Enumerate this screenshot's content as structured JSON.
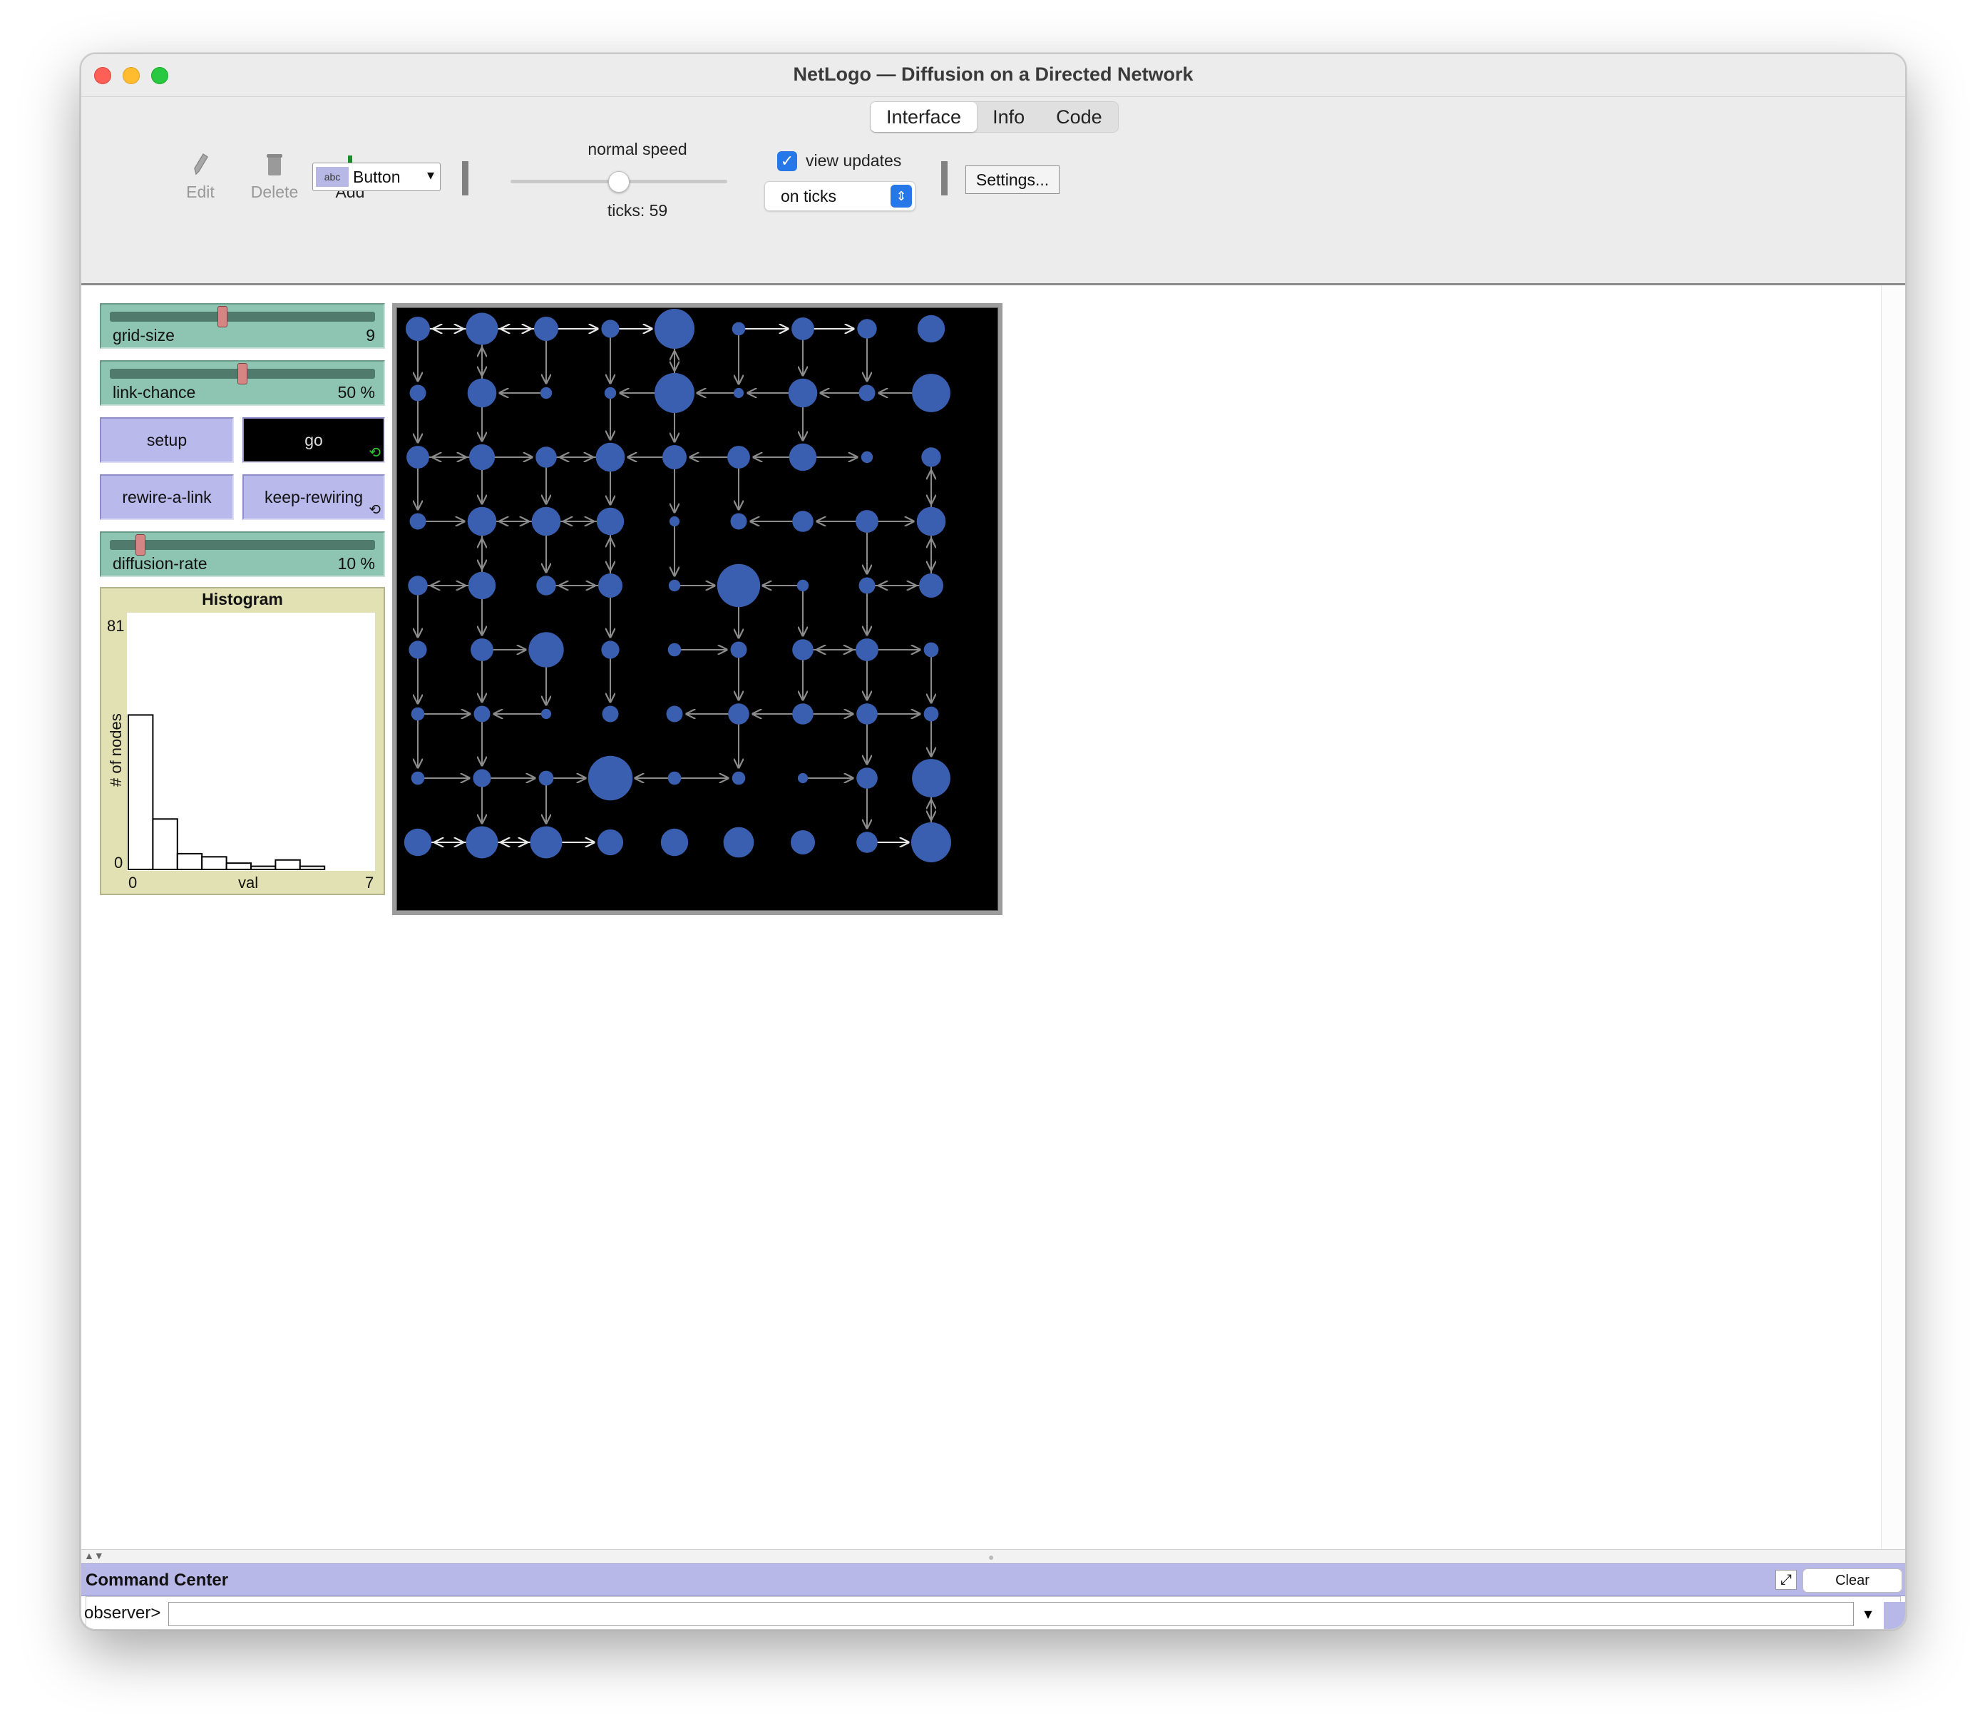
{
  "window": {
    "title": "NetLogo — Diffusion on a Directed Network"
  },
  "tabs": [
    "Interface",
    "Info",
    "Code"
  ],
  "toolbar": {
    "edit": "Edit",
    "delete": "Delete",
    "add": "Add",
    "widget_type": "Button",
    "widget_icon": "abc",
    "speed_label": "normal speed",
    "speed_value": 0.5,
    "ticks": "ticks: 59",
    "view_updates_label": "view updates",
    "view_updates_checked": true,
    "update_mode": "on ticks",
    "settings": "Settings..."
  },
  "widgets": {
    "grid_size": {
      "name": "grid-size",
      "value": "9",
      "min": 1,
      "max": 20,
      "current": 9
    },
    "link_chance": {
      "name": "link-chance",
      "value": "50 %",
      "min": 0,
      "max": 100,
      "current": 50
    },
    "setup": "setup",
    "go": "go",
    "rewire": "rewire-a-link",
    "keep_rewiring": "keep-rewiring",
    "diffusion_rate": {
      "name": "diffusion-rate",
      "value": "10 %",
      "min": 0,
      "max": 100,
      "current": 10
    }
  },
  "plot": {
    "title": "Histogram",
    "ylabel": "# of nodes",
    "xlabel": "val",
    "ymin": "0",
    "ymax": "81",
    "xmin": "0",
    "xmax": "7"
  },
  "chart_data": {
    "type": "bar",
    "title": "Histogram",
    "xlabel": "val",
    "ylabel": "# of nodes",
    "xlim": [
      0,
      7
    ],
    "ylim": [
      0,
      81
    ],
    "bin_width": 0.7,
    "values": [
      49,
      16,
      5,
      4,
      2,
      1,
      3,
      1,
      0
    ]
  },
  "world": {
    "grid": 9,
    "nodes": [
      [
        1.0,
        1.5,
        1.0,
        0.6,
        2.0,
        0.3,
        0.9,
        0.7,
        1.2
      ],
      [
        0.5,
        1.3,
        0.2,
        0.2,
        2.0,
        0.1,
        1.3,
        0.5,
        1.9
      ],
      [
        0.9,
        1.1,
        0.8,
        1.3,
        1.0,
        0.9,
        1.2,
        0.2,
        0.7
      ],
      [
        0.5,
        1.3,
        1.3,
        1.2,
        0.1,
        0.5,
        0.8,
        0.9,
        1.3
      ],
      [
        0.7,
        1.2,
        0.7,
        1.0,
        0.2,
        2.2,
        0.2,
        0.5,
        1.0
      ],
      [
        0.6,
        0.9,
        1.7,
        0.6,
        0.3,
        0.5,
        0.8,
        0.9,
        0.4
      ],
      [
        0.3,
        0.5,
        0.1,
        0.5,
        0.5,
        0.8,
        0.8,
        0.8,
        0.4
      ],
      [
        0.3,
        0.6,
        0.4,
        2.3,
        0.3,
        0.3,
        0.1,
        0.8,
        1.9
      ],
      [
        1.2,
        1.5,
        1.5,
        1.1,
        1.2,
        1.4,
        1.0,
        0.8,
        2.0
      ]
    ],
    "links": [
      [
        0,
        0,
        1,
        0
      ],
      [
        1,
        0,
        0,
        0
      ],
      [
        1,
        0,
        2,
        0
      ],
      [
        2,
        0,
        1,
        0
      ],
      [
        2,
        0,
        3,
        0
      ],
      [
        3,
        0,
        4,
        0
      ],
      [
        5,
        0,
        6,
        0
      ],
      [
        6,
        0,
        7,
        0
      ],
      [
        1,
        0,
        1,
        1
      ],
      [
        1,
        1,
        1,
        0
      ],
      [
        4,
        0,
        4,
        1
      ],
      [
        4,
        1,
        4,
        0
      ],
      [
        0,
        0,
        0,
        1
      ],
      [
        2,
        0,
        2,
        1
      ],
      [
        5,
        0,
        5,
        1
      ],
      [
        6,
        0,
        6,
        1
      ],
      [
        7,
        0,
        7,
        1
      ],
      [
        3,
        0,
        3,
        1
      ],
      [
        2,
        1,
        1,
        1
      ],
      [
        4,
        1,
        3,
        1
      ],
      [
        5,
        1,
        4,
        1
      ],
      [
        6,
        1,
        5,
        1
      ],
      [
        7,
        1,
        6,
        1
      ],
      [
        8,
        1,
        7,
        1
      ],
      [
        0,
        1,
        0,
        2
      ],
      [
        1,
        1,
        1,
        2
      ],
      [
        3,
        1,
        3,
        2
      ],
      [
        6,
        1,
        6,
        2
      ],
      [
        4,
        1,
        4,
        2
      ],
      [
        1,
        2,
        0,
        2
      ],
      [
        0,
        2,
        1,
        2
      ],
      [
        1,
        2,
        2,
        2
      ],
      [
        2,
        2,
        3,
        2
      ],
      [
        3,
        2,
        2,
        2
      ],
      [
        4,
        2,
        3,
        2
      ],
      [
        5,
        2,
        4,
        2
      ],
      [
        6,
        2,
        5,
        2
      ],
      [
        6,
        2,
        7,
        2
      ],
      [
        8,
        2,
        8,
        3
      ],
      [
        8,
        3,
        8,
        2
      ],
      [
        0,
        2,
        0,
        3
      ],
      [
        1,
        2,
        1,
        3
      ],
      [
        2,
        2,
        2,
        3
      ],
      [
        3,
        2,
        3,
        3
      ],
      [
        4,
        2,
        4,
        3
      ],
      [
        5,
        2,
        5,
        3
      ],
      [
        0,
        3,
        1,
        3
      ],
      [
        1,
        3,
        2,
        3
      ],
      [
        2,
        3,
        1,
        3
      ],
      [
        2,
        3,
        3,
        3
      ],
      [
        3,
        3,
        2,
        3
      ],
      [
        6,
        3,
        5,
        3
      ],
      [
        7,
        3,
        6,
        3
      ],
      [
        7,
        3,
        8,
        3
      ],
      [
        1,
        3,
        1,
        4
      ],
      [
        1,
        4,
        1,
        3
      ],
      [
        2,
        3,
        2,
        4
      ],
      [
        3,
        3,
        3,
        4
      ],
      [
        3,
        4,
        3,
        3
      ],
      [
        4,
        3,
        4,
        4
      ],
      [
        7,
        3,
        7,
        4
      ],
      [
        8,
        3,
        8,
        4
      ],
      [
        8,
        4,
        8,
        3
      ],
      [
        0,
        4,
        1,
        4
      ],
      [
        1,
        4,
        0,
        4
      ],
      [
        2,
        4,
        3,
        4
      ],
      [
        3,
        4,
        2,
        4
      ],
      [
        4,
        4,
        5,
        4
      ],
      [
        6,
        4,
        5,
        4
      ],
      [
        7,
        4,
        8,
        4
      ],
      [
        8,
        4,
        7,
        4
      ],
      [
        0,
        4,
        0,
        5
      ],
      [
        1,
        4,
        1,
        5
      ],
      [
        3,
        4,
        3,
        5
      ],
      [
        6,
        4,
        6,
        5
      ],
      [
        7,
        4,
        7,
        5
      ],
      [
        5,
        4,
        5,
        5
      ],
      [
        1,
        5,
        2,
        5
      ],
      [
        4,
        5,
        5,
        5
      ],
      [
        6,
        5,
        7,
        5
      ],
      [
        7,
        5,
        6,
        5
      ],
      [
        7,
        5,
        8,
        5
      ],
      [
        0,
        5,
        0,
        6
      ],
      [
        1,
        5,
        1,
        6
      ],
      [
        2,
        5,
        2,
        6
      ],
      [
        3,
        5,
        3,
        6
      ],
      [
        5,
        5,
        5,
        6
      ],
      [
        6,
        5,
        6,
        6
      ],
      [
        7,
        5,
        7,
        6
      ],
      [
        8,
        5,
        8,
        6
      ],
      [
        0,
        6,
        1,
        6
      ],
      [
        2,
        6,
        1,
        6
      ],
      [
        5,
        6,
        4,
        6
      ],
      [
        6,
        6,
        5,
        6
      ],
      [
        6,
        6,
        7,
        6
      ],
      [
        7,
        6,
        8,
        6
      ],
      [
        0,
        6,
        0,
        7
      ],
      [
        1,
        6,
        1,
        7
      ],
      [
        5,
        6,
        5,
        7
      ],
      [
        7,
        6,
        7,
        7
      ],
      [
        8,
        6,
        8,
        7
      ],
      [
        0,
        7,
        1,
        7
      ],
      [
        1,
        7,
        2,
        7
      ],
      [
        2,
        7,
        3,
        7
      ],
      [
        4,
        7,
        3,
        7
      ],
      [
        4,
        7,
        5,
        7
      ],
      [
        6,
        7,
        7,
        7
      ],
      [
        8,
        7,
        8,
        8
      ],
      [
        8,
        8,
        8,
        7
      ],
      [
        1,
        7,
        1,
        8
      ],
      [
        2,
        7,
        2,
        8
      ],
      [
        7,
        7,
        7,
        8
      ],
      [
        0,
        8,
        1,
        8
      ],
      [
        1,
        8,
        0,
        8
      ],
      [
        1,
        8,
        2,
        8
      ],
      [
        2,
        8,
        1,
        8
      ],
      [
        2,
        8,
        3,
        8
      ],
      [
        7,
        8,
        8,
        8
      ]
    ],
    "colors": {
      "node": "#3a5fb0",
      "link": "#8c8c8c",
      "link_bright": "#e8e8e8"
    }
  },
  "command_center": {
    "title": "Command Center",
    "clear": "Clear",
    "prompt": "observer>",
    "input": ""
  }
}
